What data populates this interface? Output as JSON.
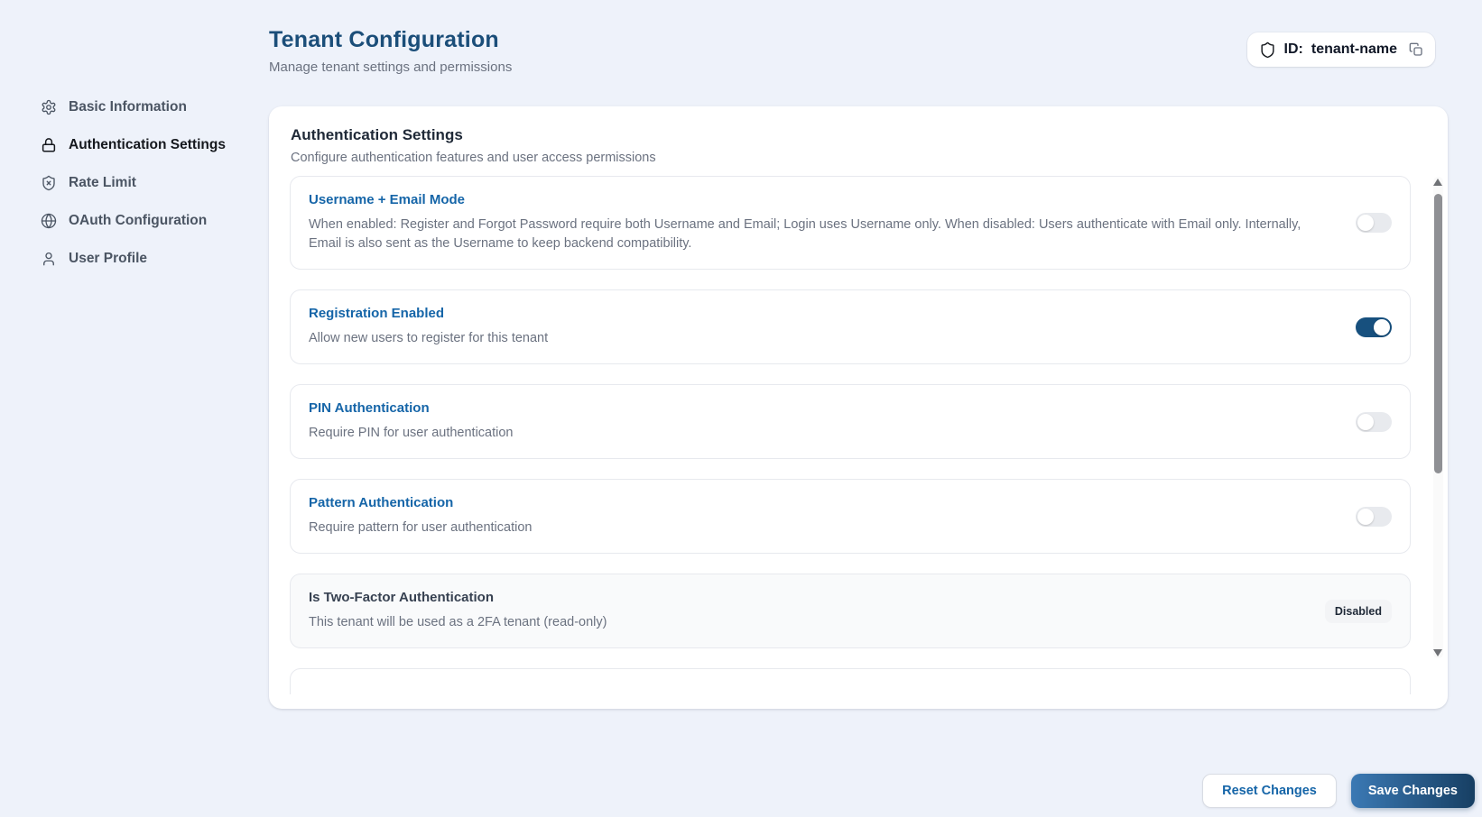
{
  "header": {
    "title": "Tenant Configuration",
    "subtitle": "Manage tenant settings and permissions",
    "tenant_badge": {
      "icon": "shield-icon",
      "label": "ID:",
      "value": "tenant-name",
      "copy_icon": "copy-icon"
    }
  },
  "sidebar": {
    "items": [
      {
        "label": "Basic Information",
        "icon": "gear-icon",
        "active": false
      },
      {
        "label": "Authentication Settings",
        "icon": "lock-icon",
        "active": true
      },
      {
        "label": "Rate Limit",
        "icon": "shield-x-icon",
        "active": false
      },
      {
        "label": "OAuth Configuration",
        "icon": "globe-icon",
        "active": false
      },
      {
        "label": "User Profile",
        "icon": "user-icon",
        "active": false
      }
    ]
  },
  "panel": {
    "title": "Authentication Settings",
    "subtitle": "Configure authentication features and user access permissions",
    "settings": [
      {
        "title": "Username + Email Mode",
        "description": "When enabled: Register and Forgot Password require both Username and Email; Login uses Username only. When disabled: Users authenticate with Email only. Internally, Email is also sent as the Username to keep backend compatibility.",
        "control": "toggle",
        "state": "off"
      },
      {
        "title": "Registration Enabled",
        "description": "Allow new users to register for this tenant",
        "control": "toggle",
        "state": "on"
      },
      {
        "title": "PIN Authentication",
        "description": "Require PIN for user authentication",
        "control": "toggle",
        "state": "off"
      },
      {
        "title": "Pattern Authentication",
        "description": "Require pattern for user authentication",
        "control": "toggle",
        "state": "off"
      },
      {
        "title": "Is Two-Factor Authentication",
        "description": "This tenant will be used as a 2FA tenant (read-only)",
        "control": "badge",
        "badge_label": "Disabled",
        "readonly": true
      }
    ]
  },
  "footer": {
    "reset_label": "Reset Changes",
    "save_label": "Save Changes"
  },
  "colors": {
    "accent": "#1565a8",
    "heading": "#1b4e79",
    "toggle_on": "#17507e",
    "save_grad_a": "#3b79b4",
    "save_grad_b": "#173f63",
    "page_bg": "#eef2fa"
  }
}
